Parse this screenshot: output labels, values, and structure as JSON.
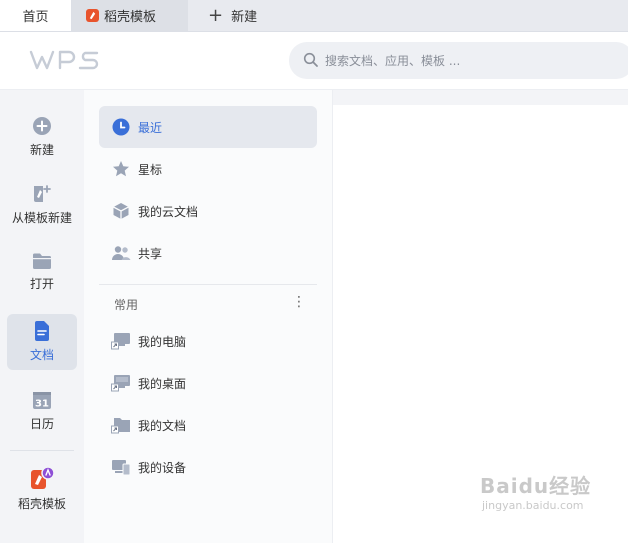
{
  "tabs": {
    "home": "首页",
    "daoke": "稻壳模板",
    "new_tab": "新建"
  },
  "header": {
    "logo": "WPS",
    "search_placeholder": "搜索文档、应用、模板 ..."
  },
  "rail": {
    "items": [
      {
        "label": "新建",
        "icon": "plus-circle-icon"
      },
      {
        "label": "从模板新建",
        "icon": "template-new-icon"
      },
      {
        "label": "打开",
        "icon": "folder-icon"
      },
      {
        "label": "文档",
        "icon": "document-icon",
        "active": true
      },
      {
        "label": "日历",
        "icon": "calendar-icon",
        "badge": "31"
      },
      {
        "label": "稻壳模板",
        "icon": "daoke-icon"
      }
    ]
  },
  "nav": {
    "items": [
      {
        "label": "最近",
        "icon": "clock-icon",
        "active": true
      },
      {
        "label": "星标",
        "icon": "star-icon"
      },
      {
        "label": "我的云文档",
        "icon": "cloud-box-icon"
      },
      {
        "label": "共享",
        "icon": "people-icon"
      }
    ],
    "section_title": "常用",
    "more": "⋮",
    "common": [
      {
        "label": "我的电脑",
        "icon": "computer-shortcut-icon"
      },
      {
        "label": "我的桌面",
        "icon": "desktop-shortcut-icon"
      },
      {
        "label": "我的文档",
        "icon": "documents-folder-icon"
      },
      {
        "label": "我的设备",
        "icon": "devices-icon"
      }
    ]
  },
  "watermark": {
    "brand": "Baidu经验",
    "url": "jingyan.baidu.com"
  },
  "colors": {
    "accent": "#3a6fd8",
    "icon_gray": "#9aa4b6",
    "daoke_orange": "#e8542d"
  }
}
